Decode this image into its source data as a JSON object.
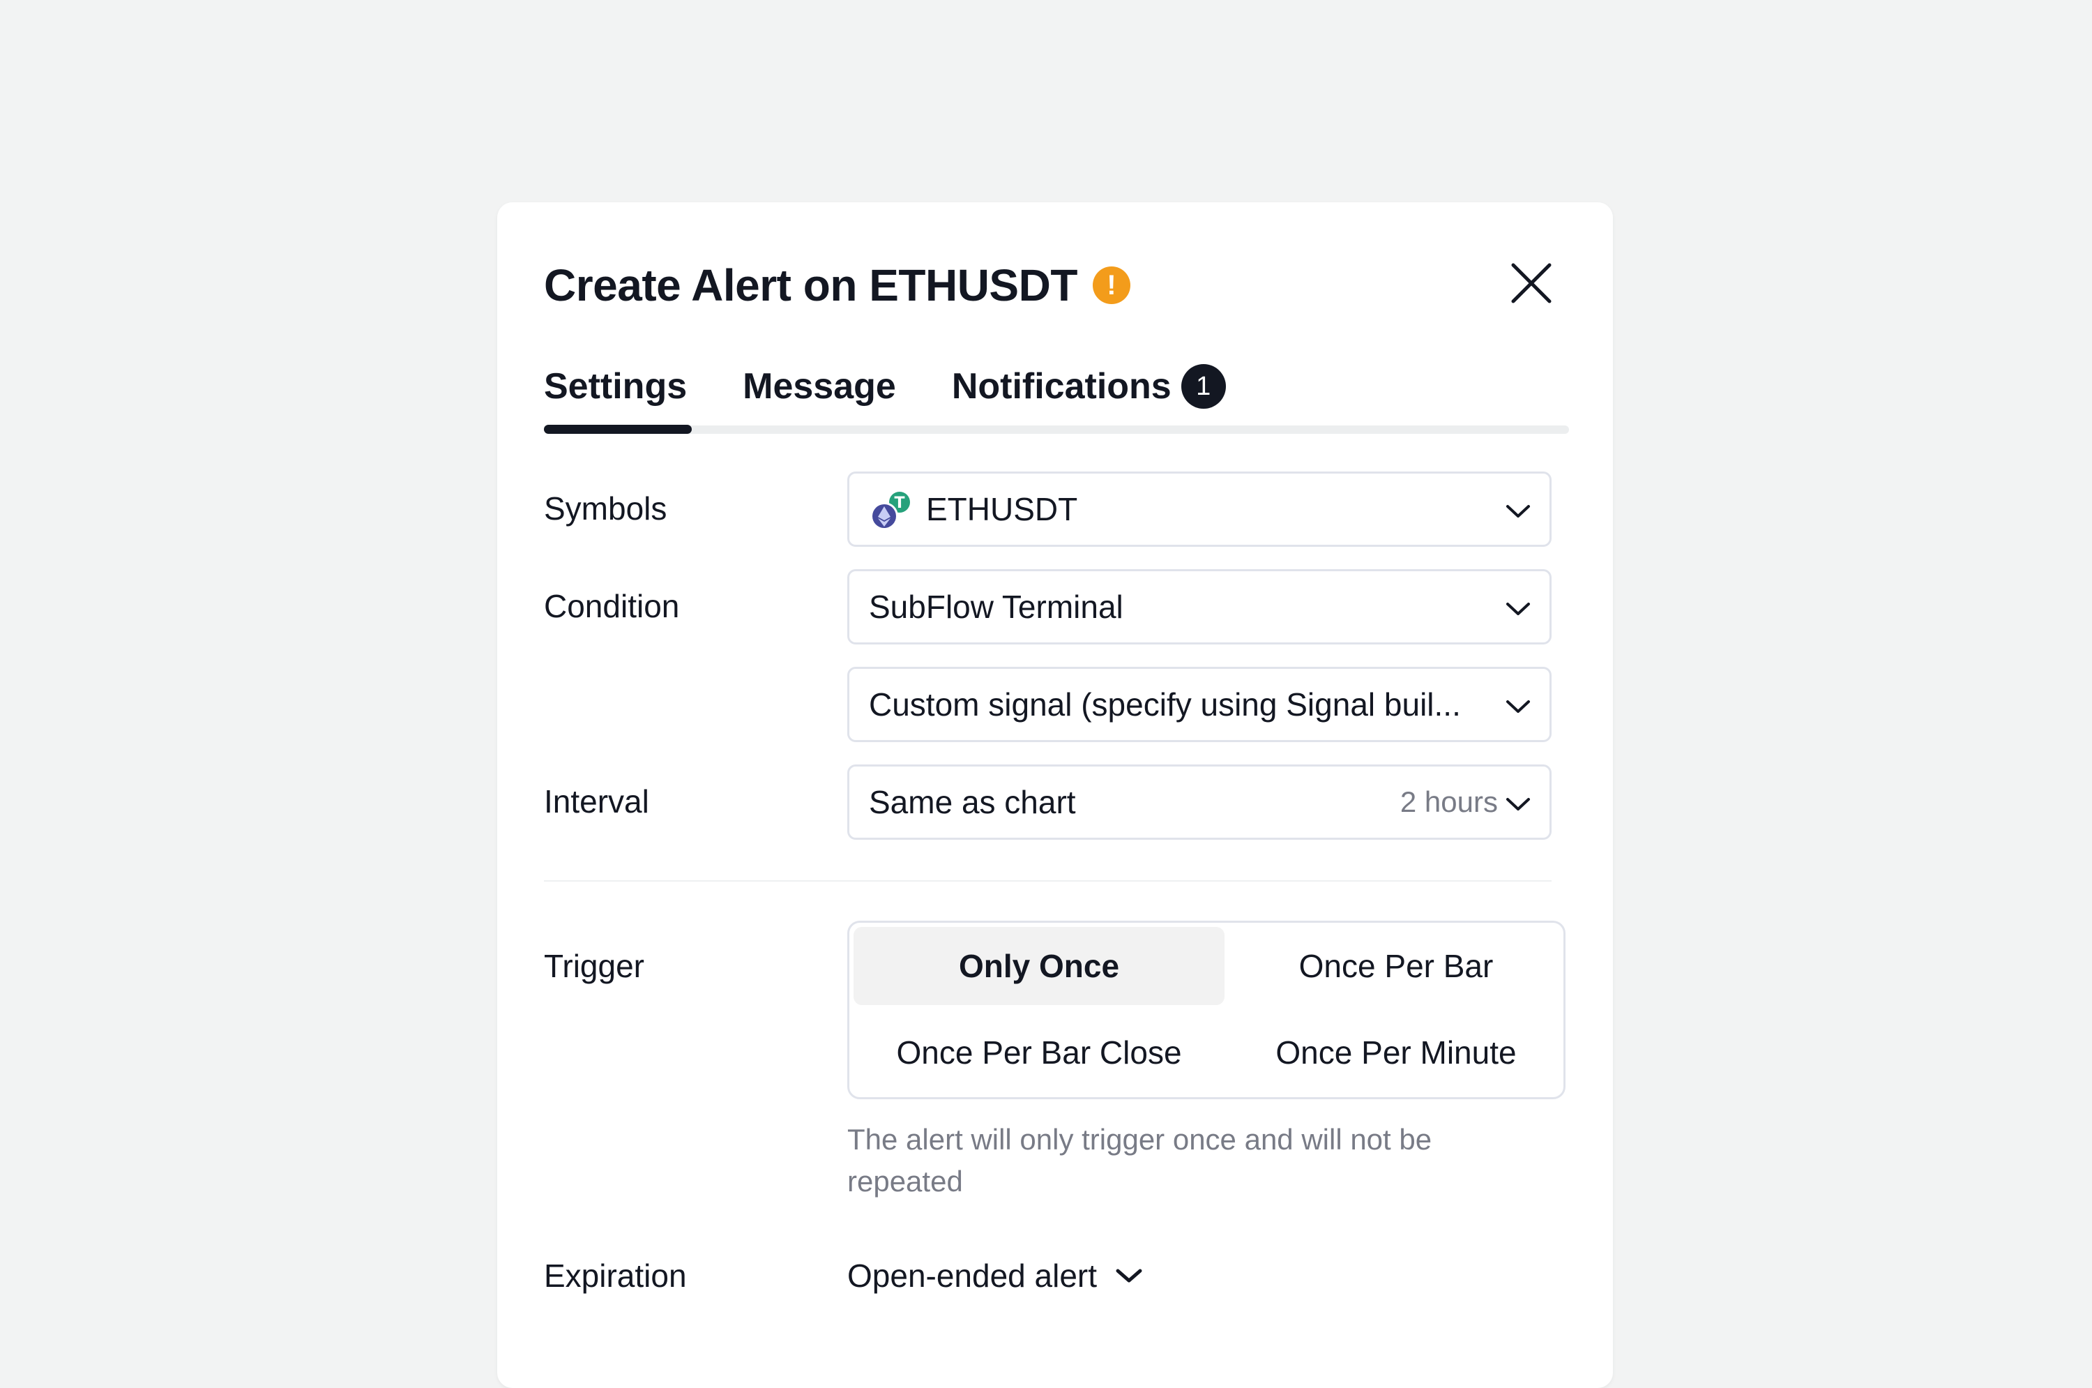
{
  "dialog": {
    "title": "Create Alert on ETHUSDT",
    "warning_icon": "!",
    "close_icon": "close-icon"
  },
  "tabs": [
    {
      "label": "Settings",
      "active": true
    },
    {
      "label": "Message",
      "active": false
    },
    {
      "label": "Notifications",
      "active": false,
      "badge": "1"
    }
  ],
  "form": {
    "symbols": {
      "label": "Symbols",
      "value": "ETHUSDT",
      "icon": "eth-usdt-coin-icon"
    },
    "condition": {
      "label": "Condition",
      "value": "SubFlow Terminal",
      "sub_value": "Custom signal (specify using Signal buil..."
    },
    "interval": {
      "label": "Interval",
      "value": "Same as chart",
      "hint": "2 hours"
    },
    "trigger": {
      "label": "Trigger",
      "options": [
        "Only Once",
        "Once Per Bar",
        "Once Per Bar Close",
        "Once Per Minute"
      ],
      "selected": "Only Once",
      "description": "The alert will only trigger once and will not be repeated"
    },
    "expiration": {
      "label": "Expiration",
      "value": "Open-ended alert"
    }
  },
  "colors": {
    "background": "#f2f3f3",
    "dialog": "#ffffff",
    "warning": "#f39c1b",
    "text": "#131722",
    "muted": "#787b86",
    "border": "#e0e3eb"
  }
}
